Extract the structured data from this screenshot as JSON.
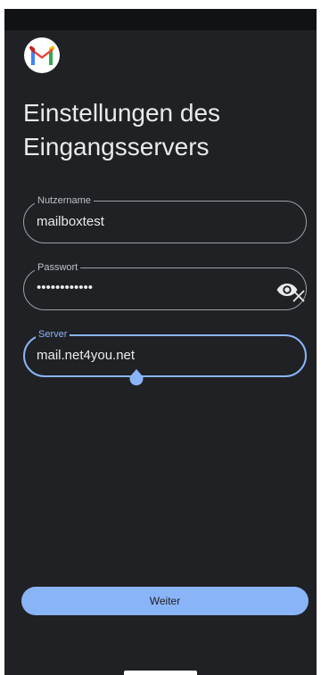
{
  "app": {
    "logo_icon": "gmail-logo-icon",
    "title": "Einstellungen des Eingangsservers"
  },
  "form": {
    "username": {
      "label": "Nutzername",
      "value": "mailboxtest"
    },
    "password": {
      "label": "Passwort",
      "value": "••••••••••••",
      "toggle_icon": "eye-icon",
      "clear_icon": "close-icon"
    },
    "server": {
      "label": "Server",
      "value": "mail.net4you.net"
    }
  },
  "actions": {
    "next_label": "Weiter"
  },
  "colors": {
    "background": "#202124",
    "accent": "#8ab4f8",
    "text": "#e8eaed",
    "outline": "#9aa0a6"
  }
}
